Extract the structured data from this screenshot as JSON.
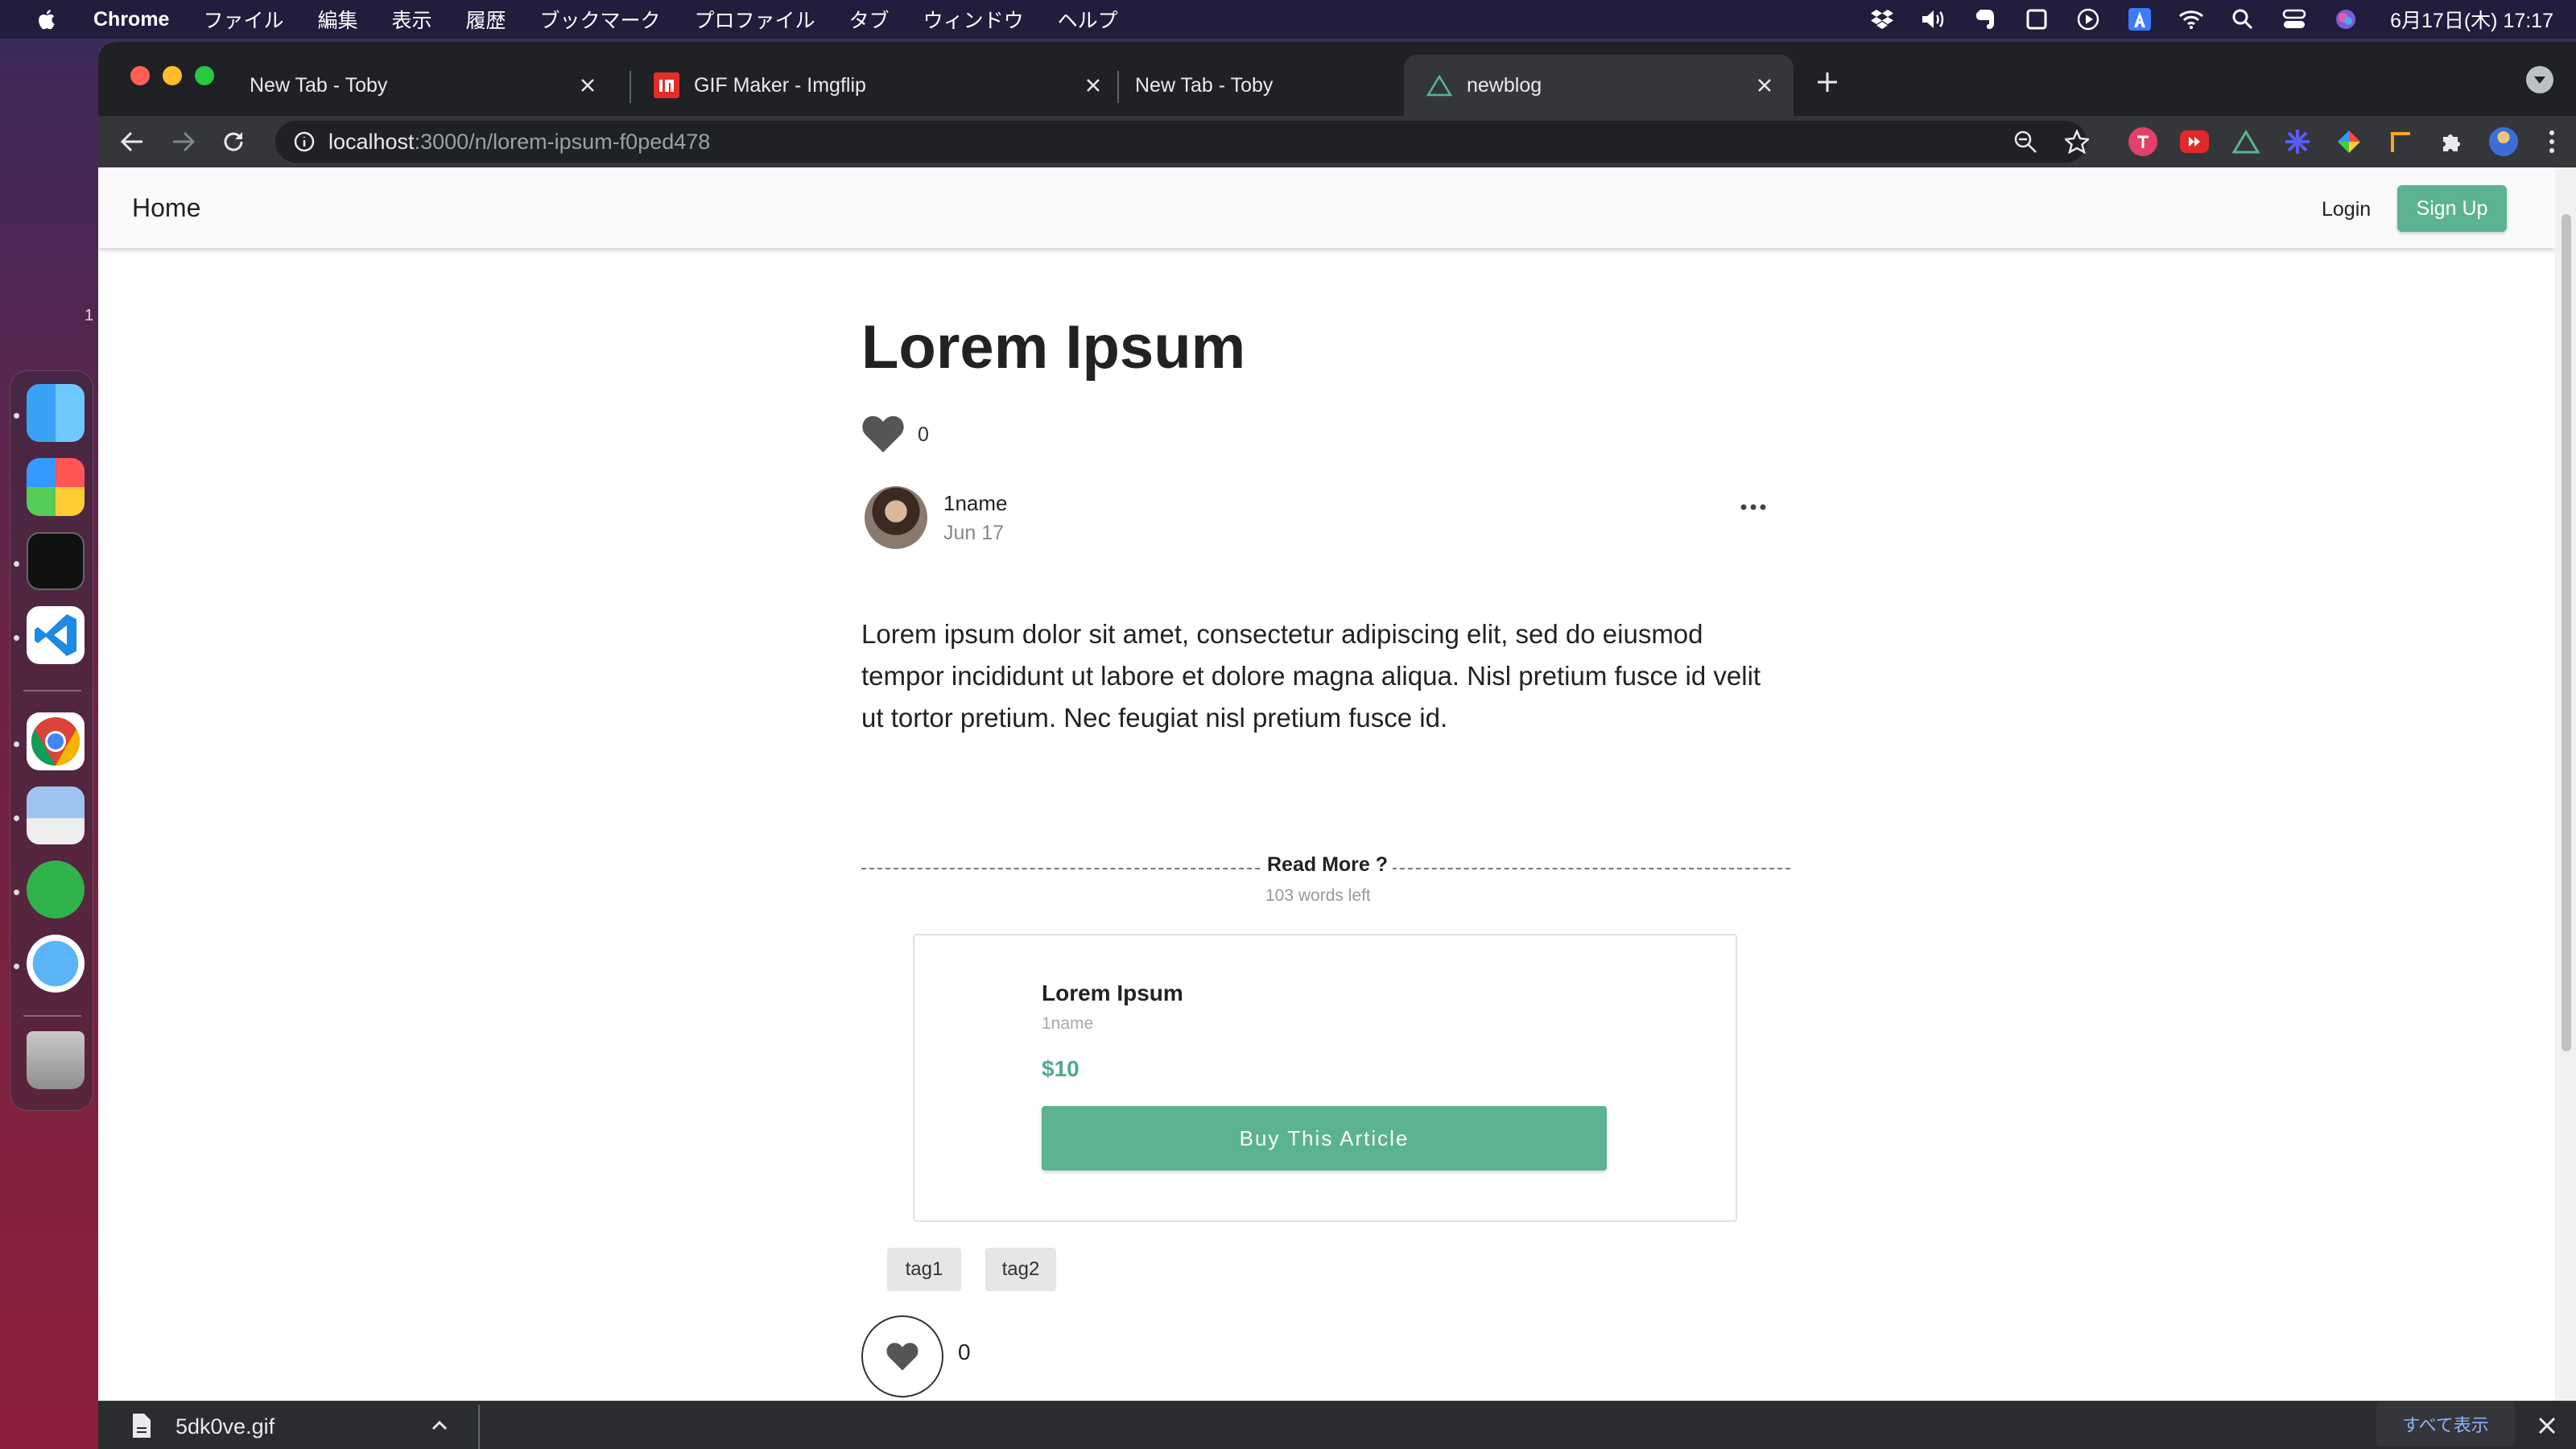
{
  "menubar": {
    "app_name": "Chrome",
    "items": [
      "ファイル",
      "編集",
      "表示",
      "履歴",
      "ブックマーク",
      "プロファイル",
      "タブ",
      "ウィンドウ",
      "ヘルプ"
    ],
    "clock": "6月17日(木)  17:17"
  },
  "dock": {
    "badge": "1"
  },
  "tabs": [
    {
      "title": "New Tab - Toby"
    },
    {
      "title": "GIF Maker - Imgflip"
    },
    {
      "title": "New Tab - Toby"
    },
    {
      "title": "newblog"
    }
  ],
  "address": {
    "host": "localhost",
    "path": ":3000/n/lorem-ipsum-f0ped478"
  },
  "site_nav": {
    "home": "Home",
    "login": "Login",
    "signup": "Sign Up"
  },
  "article": {
    "title": "Lorem Ipsum",
    "like_count": "0",
    "author": "1name",
    "date": "Jun 17",
    "body": "Lorem ipsum dolor sit amet, consectetur adipiscing elit, sed do eiusmod tempor incididunt ut labore et dolore magna aliqua. Nisl pretium fusce id velit ut tortor pretium. Nec feugiat nisl pretium fusce id.",
    "read_more": "Read More ?",
    "words_left": "103 words left",
    "tags": [
      "tag1",
      "tag2"
    ],
    "bottom_like_count": "0"
  },
  "paywall": {
    "title": "Lorem Ipsum",
    "author": "1name",
    "price": "$10",
    "buy_label": "Buy This Article"
  },
  "downloads": {
    "file_name": "5dk0ve.gif",
    "show_all": "すべて表示"
  },
  "colors": {
    "accent": "#5bb391",
    "price": "#4fa986"
  }
}
